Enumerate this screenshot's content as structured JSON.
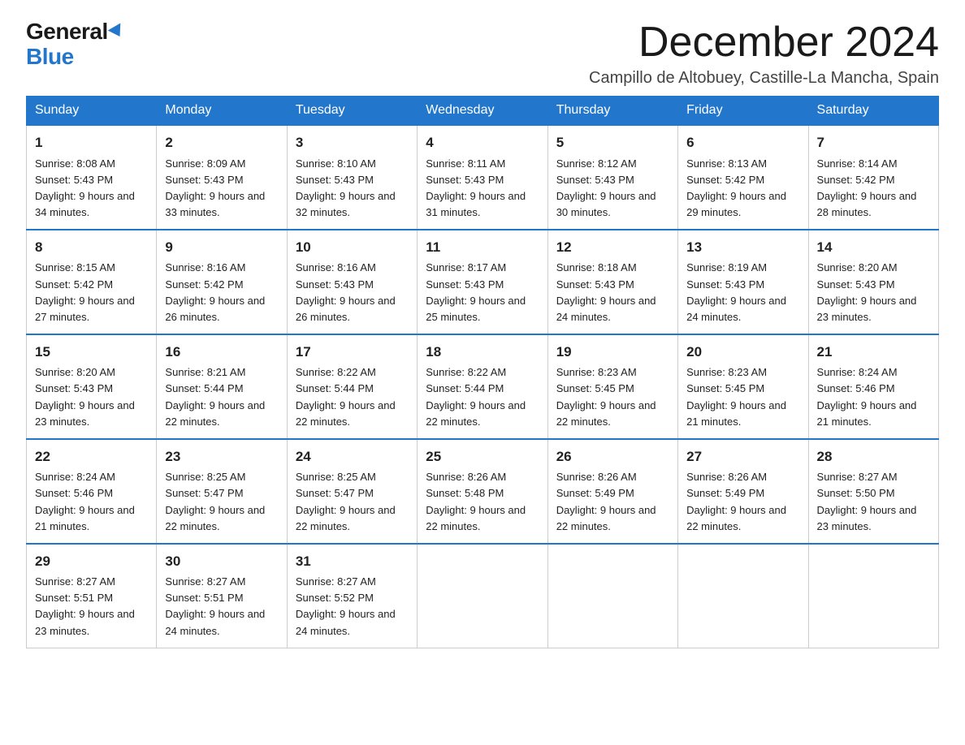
{
  "header": {
    "logo_general": "General",
    "logo_blue": "Blue",
    "month_title": "December 2024",
    "location": "Campillo de Altobuey, Castille-La Mancha, Spain"
  },
  "weekdays": [
    "Sunday",
    "Monday",
    "Tuesday",
    "Wednesday",
    "Thursday",
    "Friday",
    "Saturday"
  ],
  "weeks": [
    [
      {
        "day": "1",
        "sunrise": "8:08 AM",
        "sunset": "5:43 PM",
        "daylight": "9 hours and 34 minutes."
      },
      {
        "day": "2",
        "sunrise": "8:09 AM",
        "sunset": "5:43 PM",
        "daylight": "9 hours and 33 minutes."
      },
      {
        "day": "3",
        "sunrise": "8:10 AM",
        "sunset": "5:43 PM",
        "daylight": "9 hours and 32 minutes."
      },
      {
        "day": "4",
        "sunrise": "8:11 AM",
        "sunset": "5:43 PM",
        "daylight": "9 hours and 31 minutes."
      },
      {
        "day": "5",
        "sunrise": "8:12 AM",
        "sunset": "5:43 PM",
        "daylight": "9 hours and 30 minutes."
      },
      {
        "day": "6",
        "sunrise": "8:13 AM",
        "sunset": "5:42 PM",
        "daylight": "9 hours and 29 minutes."
      },
      {
        "day": "7",
        "sunrise": "8:14 AM",
        "sunset": "5:42 PM",
        "daylight": "9 hours and 28 minutes."
      }
    ],
    [
      {
        "day": "8",
        "sunrise": "8:15 AM",
        "sunset": "5:42 PM",
        "daylight": "9 hours and 27 minutes."
      },
      {
        "day": "9",
        "sunrise": "8:16 AM",
        "sunset": "5:42 PM",
        "daylight": "9 hours and 26 minutes."
      },
      {
        "day": "10",
        "sunrise": "8:16 AM",
        "sunset": "5:43 PM",
        "daylight": "9 hours and 26 minutes."
      },
      {
        "day": "11",
        "sunrise": "8:17 AM",
        "sunset": "5:43 PM",
        "daylight": "9 hours and 25 minutes."
      },
      {
        "day": "12",
        "sunrise": "8:18 AM",
        "sunset": "5:43 PM",
        "daylight": "9 hours and 24 minutes."
      },
      {
        "day": "13",
        "sunrise": "8:19 AM",
        "sunset": "5:43 PM",
        "daylight": "9 hours and 24 minutes."
      },
      {
        "day": "14",
        "sunrise": "8:20 AM",
        "sunset": "5:43 PM",
        "daylight": "9 hours and 23 minutes."
      }
    ],
    [
      {
        "day": "15",
        "sunrise": "8:20 AM",
        "sunset": "5:43 PM",
        "daylight": "9 hours and 23 minutes."
      },
      {
        "day": "16",
        "sunrise": "8:21 AM",
        "sunset": "5:44 PM",
        "daylight": "9 hours and 22 minutes."
      },
      {
        "day": "17",
        "sunrise": "8:22 AM",
        "sunset": "5:44 PM",
        "daylight": "9 hours and 22 minutes."
      },
      {
        "day": "18",
        "sunrise": "8:22 AM",
        "sunset": "5:44 PM",
        "daylight": "9 hours and 22 minutes."
      },
      {
        "day": "19",
        "sunrise": "8:23 AM",
        "sunset": "5:45 PM",
        "daylight": "9 hours and 22 minutes."
      },
      {
        "day": "20",
        "sunrise": "8:23 AM",
        "sunset": "5:45 PM",
        "daylight": "9 hours and 21 minutes."
      },
      {
        "day": "21",
        "sunrise": "8:24 AM",
        "sunset": "5:46 PM",
        "daylight": "9 hours and 21 minutes."
      }
    ],
    [
      {
        "day": "22",
        "sunrise": "8:24 AM",
        "sunset": "5:46 PM",
        "daylight": "9 hours and 21 minutes."
      },
      {
        "day": "23",
        "sunrise": "8:25 AM",
        "sunset": "5:47 PM",
        "daylight": "9 hours and 22 minutes."
      },
      {
        "day": "24",
        "sunrise": "8:25 AM",
        "sunset": "5:47 PM",
        "daylight": "9 hours and 22 minutes."
      },
      {
        "day": "25",
        "sunrise": "8:26 AM",
        "sunset": "5:48 PM",
        "daylight": "9 hours and 22 minutes."
      },
      {
        "day": "26",
        "sunrise": "8:26 AM",
        "sunset": "5:49 PM",
        "daylight": "9 hours and 22 minutes."
      },
      {
        "day": "27",
        "sunrise": "8:26 AM",
        "sunset": "5:49 PM",
        "daylight": "9 hours and 22 minutes."
      },
      {
        "day": "28",
        "sunrise": "8:27 AM",
        "sunset": "5:50 PM",
        "daylight": "9 hours and 23 minutes."
      }
    ],
    [
      {
        "day": "29",
        "sunrise": "8:27 AM",
        "sunset": "5:51 PM",
        "daylight": "9 hours and 23 minutes."
      },
      {
        "day": "30",
        "sunrise": "8:27 AM",
        "sunset": "5:51 PM",
        "daylight": "9 hours and 24 minutes."
      },
      {
        "day": "31",
        "sunrise": "8:27 AM",
        "sunset": "5:52 PM",
        "daylight": "9 hours and 24 minutes."
      },
      null,
      null,
      null,
      null
    ]
  ]
}
